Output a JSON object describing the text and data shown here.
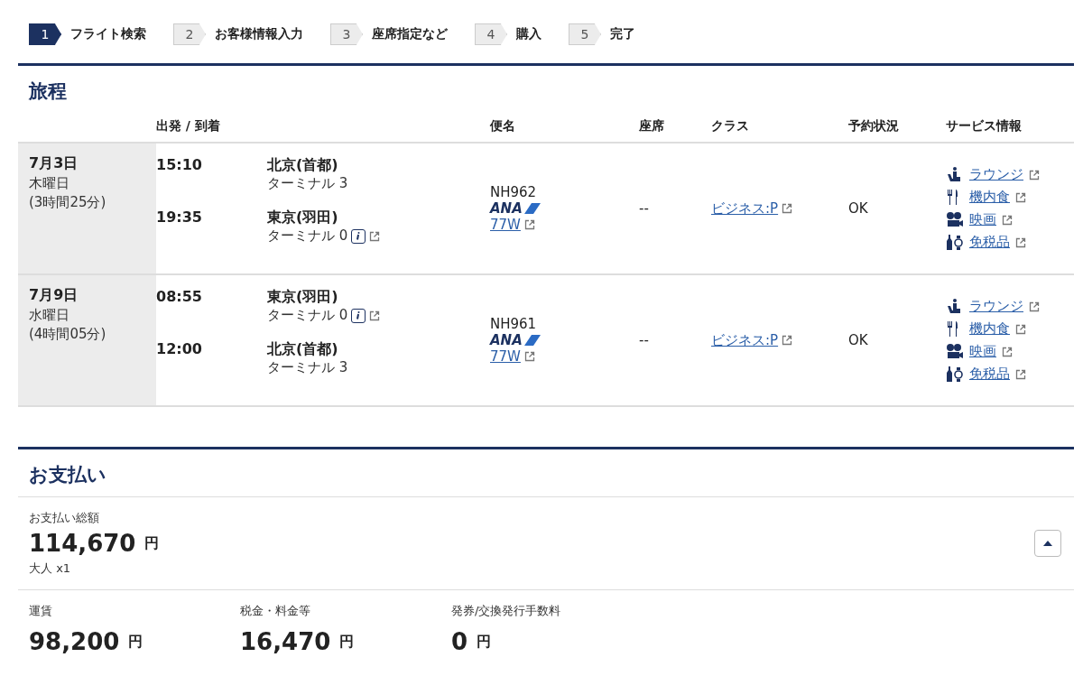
{
  "steps": [
    {
      "number": "1",
      "label": "フライト検索",
      "selected": true
    },
    {
      "number": "2",
      "label": "お客様情報入力",
      "selected": false
    },
    {
      "number": "3",
      "label": "座席指定など",
      "selected": false
    },
    {
      "number": "4",
      "label": "購入",
      "selected": false
    },
    {
      "number": "5",
      "label": "完了",
      "selected": false
    }
  ],
  "itinerary": {
    "title": "旅程",
    "columns": [
      "出発 / 到着",
      "便名",
      "座席",
      "クラス",
      "予約状況",
      "サービス情報"
    ],
    "rows": [
      {
        "date": "7月3日",
        "weekday": "木曜日",
        "duration": "(3時間25分)",
        "legs": [
          {
            "time": "15:10",
            "city": "北京(首都)",
            "terminal": "ターミナル 3",
            "info": false
          },
          {
            "time": "19:35",
            "city": "東京(羽田)",
            "terminal": "ターミナル 0",
            "info": true
          }
        ],
        "flight": "NH962",
        "airline": "ANA",
        "aircraft": "77W",
        "seat": "--",
        "class": "ビジネス:P",
        "status": "OK",
        "services": [
          {
            "kind": "lounge",
            "label": "ラウンジ"
          },
          {
            "kind": "meal",
            "label": "機内食"
          },
          {
            "kind": "movie",
            "label": "映画"
          },
          {
            "kind": "dutyfree",
            "label": "免税品"
          }
        ]
      },
      {
        "date": "7月9日",
        "weekday": "水曜日",
        "duration": "(4時間05分)",
        "legs": [
          {
            "time": "08:55",
            "city": "東京(羽田)",
            "terminal": "ターミナル 0",
            "info": true
          },
          {
            "time": "12:00",
            "city": "北京(首都)",
            "terminal": "ターミナル 3",
            "info": false
          }
        ],
        "flight": "NH961",
        "airline": "ANA",
        "aircraft": "77W",
        "seat": "--",
        "class": "ビジネス:P",
        "status": "OK",
        "services": [
          {
            "kind": "lounge",
            "label": "ラウンジ"
          },
          {
            "kind": "meal",
            "label": "機内食"
          },
          {
            "kind": "movie",
            "label": "映画"
          },
          {
            "kind": "dutyfree",
            "label": "免税品"
          }
        ]
      }
    ]
  },
  "payment": {
    "title": "お支払い",
    "total_label": "お支払い総額",
    "total": {
      "value": "114,670",
      "unit": "円"
    },
    "passengers": "大人 x1",
    "expanded": true,
    "breakdown": [
      {
        "label": "運賃",
        "value": "98,200",
        "unit": "円"
      },
      {
        "label": "税金・料金等",
        "value": "16,470",
        "unit": "円"
      },
      {
        "label": "発券/交換発行手数料",
        "value": "0",
        "unit": "円"
      }
    ]
  }
}
